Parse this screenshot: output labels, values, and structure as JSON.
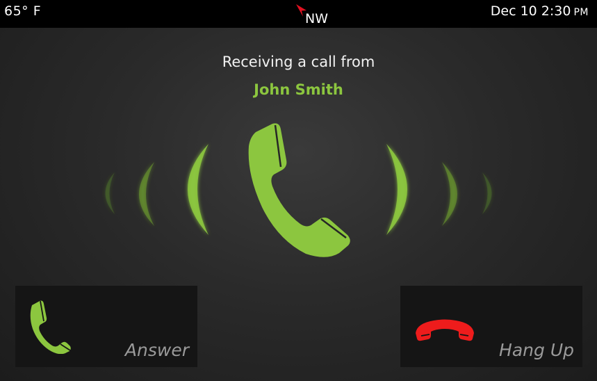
{
  "status_bar": {
    "temperature": "65° F",
    "compass_heading": "NW",
    "date_time": "Dec 10 2:30",
    "am_pm": "PM"
  },
  "call": {
    "prompt": "Receiving a call from",
    "caller_name": "John Smith"
  },
  "actions": {
    "answer_label": "Answer",
    "hangup_label": "Hang Up"
  },
  "icons": {
    "compass": "compass-arrow-icon",
    "incoming_call": "phone-ringing-icon",
    "answer": "phone-icon",
    "hangup": "phone-hangup-icon"
  },
  "colors": {
    "accent_green": "#8cc63f",
    "hangup_red": "#ee1c1c",
    "compass_red": "#e01020",
    "background": "#2a2a2a",
    "button_bg": "#151515",
    "button_label": "#9a9a9a"
  }
}
